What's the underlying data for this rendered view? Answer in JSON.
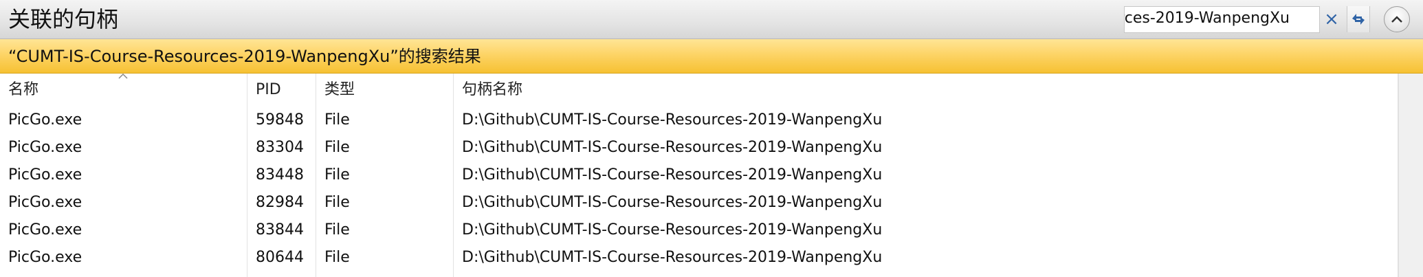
{
  "window": {
    "title": "关联的句柄"
  },
  "search": {
    "value": "CUMT-IS-Course-Resources-2019-WanpengXu",
    "clear_symbol": "×"
  },
  "banner": {
    "text": "“CUMT-IS-Course-Resources-2019-WanpengXu”的搜索结果"
  },
  "table": {
    "columns": [
      {
        "label": "名称"
      },
      {
        "label": "PID"
      },
      {
        "label": "类型"
      },
      {
        "label": "句柄名称"
      }
    ],
    "sort": {
      "column": "名称",
      "direction": "ascending"
    },
    "rows": [
      {
        "name": "PicGo.exe",
        "pid": "59848",
        "type": "File",
        "handle": "D:\\Github\\CUMT-IS-Course-Resources-2019-WanpengXu"
      },
      {
        "name": "PicGo.exe",
        "pid": "83304",
        "type": "File",
        "handle": "D:\\Github\\CUMT-IS-Course-Resources-2019-WanpengXu"
      },
      {
        "name": "PicGo.exe",
        "pid": "83448",
        "type": "File",
        "handle": "D:\\Github\\CUMT-IS-Course-Resources-2019-WanpengXu"
      },
      {
        "name": "PicGo.exe",
        "pid": "82984",
        "type": "File",
        "handle": "D:\\Github\\CUMT-IS-Course-Resources-2019-WanpengXu"
      },
      {
        "name": "PicGo.exe",
        "pid": "83844",
        "type": "File",
        "handle": "D:\\Github\\CUMT-IS-Course-Resources-2019-WanpengXu"
      },
      {
        "name": "PicGo.exe",
        "pid": "80644",
        "type": "File",
        "handle": "D:\\Github\\CUMT-IS-Course-Resources-2019-WanpengXu"
      }
    ]
  },
  "icons": {
    "clear": "close-icon",
    "refresh": "refresh-arrows-icon",
    "collapse": "chevron-up-icon",
    "sort": "sort-ascending-icon"
  },
  "colors": {
    "banner_top": "#ffe596",
    "banner_bottom": "#f6c132",
    "accent_blue": "#2f63a6",
    "titlebar": "#e4e4e4"
  }
}
